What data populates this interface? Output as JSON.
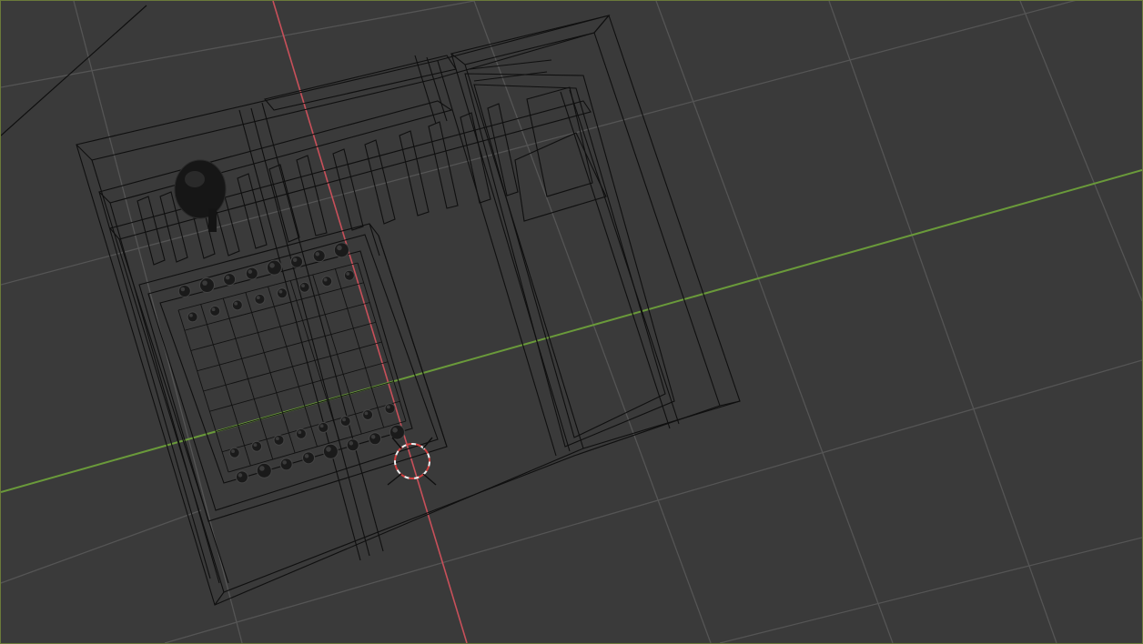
{
  "app": {
    "editor": "3D Viewport",
    "view_mode": "wireframe"
  },
  "colors": {
    "background": "#3a3a3a",
    "grid_line": "#555555",
    "axis_x": "#c8505a",
    "axis_y": "#6a9a3a",
    "wire": "#0f0f0f",
    "viewport_border": "#6b7a3a",
    "cursor_red": "#d44040",
    "cursor_white": "#f0f0f0"
  },
  "scene": {
    "objects": [
      {
        "name": "chess-table-frame",
        "type": "mesh"
      },
      {
        "name": "chess-board",
        "type": "mesh"
      },
      {
        "name": "chess-pieces",
        "type": "mesh"
      },
      {
        "name": "shelf-dividers",
        "type": "mesh"
      },
      {
        "name": "side-cabinet",
        "type": "mesh"
      },
      {
        "name": "pendant-lamp",
        "type": "mesh"
      }
    ],
    "board_rows": 8,
    "board_cols": 8
  }
}
